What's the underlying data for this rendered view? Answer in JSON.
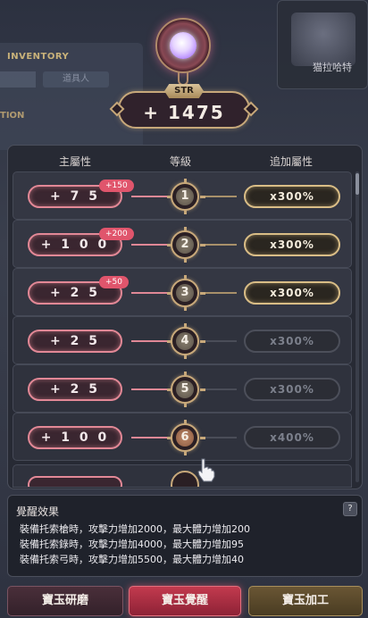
{
  "background": {
    "inventory_label": "INVENTORY",
    "tab_label": "道具人",
    "section_label": "TION",
    "character_name": "猫拉哈特"
  },
  "stat": {
    "label": "STR",
    "value": "+ 1475"
  },
  "columns": {
    "main": "主屬性",
    "level": "等級",
    "extra": "追加屬性"
  },
  "rows": [
    {
      "attr": "+ 7 5",
      "bonus": "+150",
      "level": "1",
      "pct": "x300%",
      "active": true
    },
    {
      "attr": "+ 1 0 0",
      "bonus": "+200",
      "level": "2",
      "pct": "x300%",
      "active": true
    },
    {
      "attr": "+ 2 5",
      "bonus": "+50",
      "level": "3",
      "pct": "x300%",
      "active": true
    },
    {
      "attr": "+ 2 5",
      "bonus": "",
      "level": "4",
      "pct": "x300%",
      "active": false
    },
    {
      "attr": "+ 2 5",
      "bonus": "",
      "level": "5",
      "pct": "x300%",
      "active": false
    },
    {
      "attr": "+ 1 0 0",
      "bonus": "",
      "level": "6",
      "pct": "x400%",
      "active": false
    }
  ],
  "effect": {
    "title": "覺醒效果",
    "help": "?",
    "lines": [
      "裝備托索槍時，攻擊力增加2000，最大體力增加200",
      "裝備托索錄時，攻擊力增加4000，最大體力增加95",
      "裝備托索弓時，攻擊力增加5500，最大體力增加40"
    ]
  },
  "buttons": {
    "polish": "寶玉研磨",
    "awaken": "寶玉覺醒",
    "process": "寶玉加工"
  },
  "colors": {
    "accent_pink": "#e28896",
    "accent_gold": "#d9bd86",
    "awaken_button": "#c23a4e"
  }
}
